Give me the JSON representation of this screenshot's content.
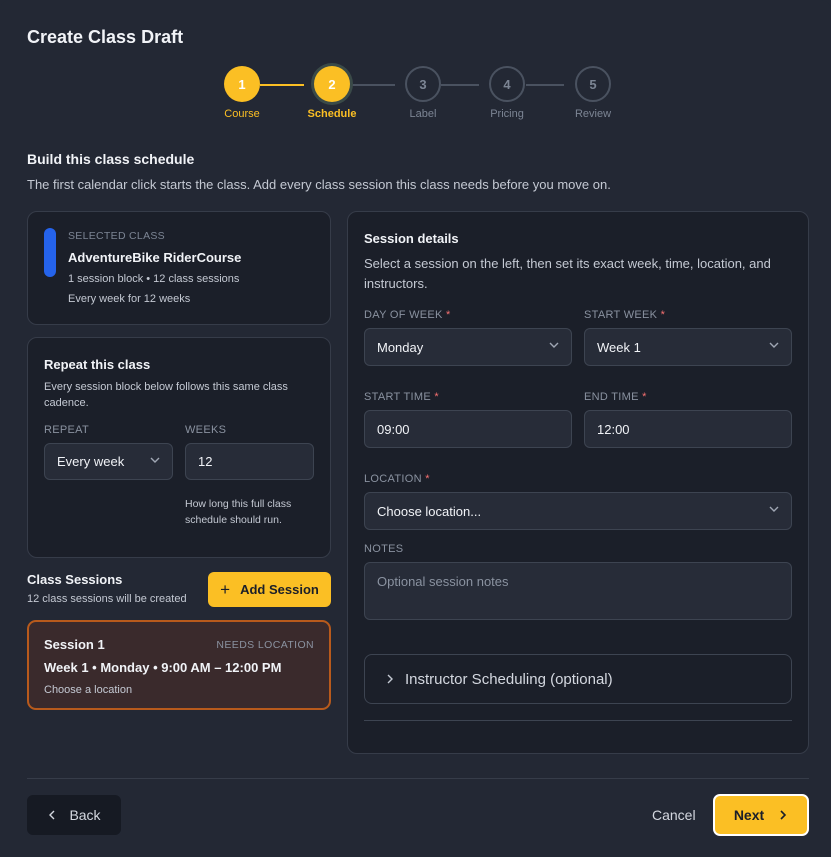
{
  "title": "Create Class Draft",
  "steps": [
    {
      "num": "1",
      "label": "Course"
    },
    {
      "num": "2",
      "label": "Schedule"
    },
    {
      "num": "3",
      "label": "Label"
    },
    {
      "num": "4",
      "label": "Pricing"
    },
    {
      "num": "5",
      "label": "Review"
    }
  ],
  "section": {
    "title": "Build this class schedule",
    "subtitle": "The first calendar click starts the class. Add every class session this class needs before you move on."
  },
  "selected_class": {
    "caption": "SELECTED CLASS",
    "name": "AdventureBike RiderCourse",
    "meta1": "1 session block • 12 class sessions",
    "meta2": "Every week for 12 weeks",
    "color": "#2563eb"
  },
  "repeat": {
    "title": "Repeat this class",
    "subtitle": "Every session block below follows this same class cadence.",
    "repeat_label": "REPEAT",
    "repeat_value": "Every week",
    "weeks_label": "WEEKS",
    "weeks_value": "12",
    "weeks_hint": "How long this full class schedule should run."
  },
  "class_sessions": {
    "title": "Class Sessions",
    "subtitle": "12 class sessions will be created",
    "add_label": "Add Session",
    "sessions": [
      {
        "name": "Session 1",
        "badge": "NEEDS LOCATION",
        "time": "Week 1 • Monday • 9:00 AM – 12:00 PM",
        "location": "Choose a location"
      }
    ]
  },
  "details": {
    "title": "Session details",
    "subtitle": "Select a session on the left, then set its exact week, time, location, and instructors.",
    "day_label": "DAY OF WEEK",
    "day_value": "Monday",
    "week_label": "START WEEK",
    "week_value": "Week 1",
    "start_label": "START TIME",
    "start_value": "09:00",
    "end_label": "END TIME",
    "end_value": "12:00",
    "location_label": "LOCATION",
    "location_value": "Choose location...",
    "notes_label": "NOTES",
    "notes_placeholder": "Optional session notes",
    "instructor_label": "Instructor Scheduling (optional)",
    "required_mark": "*"
  },
  "footer": {
    "back": "Back",
    "cancel": "Cancel",
    "next": "Next"
  },
  "colors": {
    "accent": "#fbbf24",
    "background": "#232834",
    "warning_border": "#b85a1c"
  }
}
